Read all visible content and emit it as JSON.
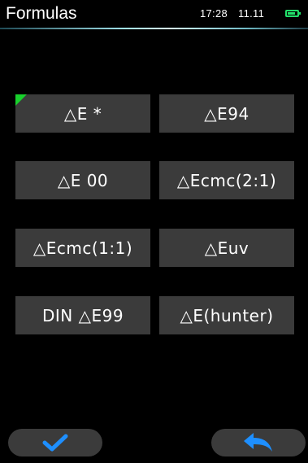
{
  "header": {
    "title": "Formulas",
    "time": "17:28",
    "date": "11.11",
    "battery_color": "#22e06a"
  },
  "formulas": [
    {
      "label": "△E *",
      "selected": true
    },
    {
      "label": "△E94",
      "selected": false
    },
    {
      "label": "△E 00",
      "selected": false
    },
    {
      "label": "△Ecmc(2:1)",
      "selected": false
    },
    {
      "label": "△Ecmc(1:1)",
      "selected": false
    },
    {
      "label": "△Euv",
      "selected": false
    },
    {
      "label": "DIN △E99",
      "selected": false
    },
    {
      "label": "△E(hunter)",
      "selected": false
    }
  ],
  "footer": {
    "confirm_icon": "checkmark-icon",
    "back_icon": "back-arrow-icon",
    "accent_color": "#1e8fff"
  },
  "colors": {
    "background": "#000000",
    "button": "#3b3b3b",
    "selected_marker": "#18d02c"
  }
}
